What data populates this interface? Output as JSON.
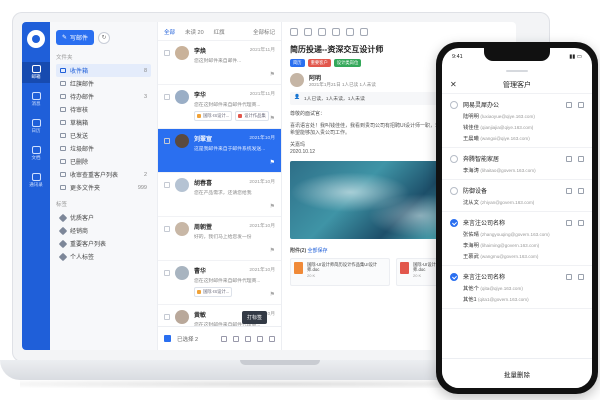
{
  "rail": {
    "items": [
      {
        "label": "邮箱",
        "active": true
      },
      {
        "label": "消息",
        "active": false
      },
      {
        "label": "日历",
        "active": false
      },
      {
        "label": "文档",
        "active": false
      },
      {
        "label": "通讯录",
        "active": false
      }
    ]
  },
  "folders": {
    "compose_label": "写邮件",
    "section_title": "文件夹",
    "items": [
      {
        "label": "收件箱",
        "count": "8",
        "active": true
      },
      {
        "label": "红旗邮件",
        "count": "",
        "active": false
      },
      {
        "label": "待办邮件",
        "count": "3",
        "active": false
      },
      {
        "label": "待审核",
        "count": "",
        "active": false
      },
      {
        "label": "草稿箱",
        "count": "",
        "active": false
      },
      {
        "label": "已发送",
        "count": "",
        "active": false
      },
      {
        "label": "垃圾邮件",
        "count": "",
        "active": false
      },
      {
        "label": "已删除",
        "count": "",
        "active": false
      },
      {
        "label": "收审查重客户列表",
        "count": "2",
        "active": false
      },
      {
        "label": "更多文件夹",
        "count": "999",
        "active": false
      }
    ],
    "tag_title": "标签",
    "tags": [
      {
        "label": "优质客户",
        "color": "#7d8799"
      },
      {
        "label": "经销商",
        "color": "#7d8799"
      },
      {
        "label": "重要客户列表",
        "color": "#7d8799"
      },
      {
        "label": "个人标签",
        "color": "#7d8799"
      }
    ]
  },
  "maillist": {
    "tabs": [
      {
        "label": "全部",
        "active": true
      },
      {
        "label": "未读 20",
        "active": false
      },
      {
        "label": "红旗",
        "active": false
      },
      {
        "label": "全部标记",
        "active": false
      }
    ],
    "mails": [
      {
        "name": "李焕",
        "date": "2021年11月",
        "subject": "您这封邮件来自邮件...",
        "chips": [],
        "selected": false,
        "avatar": "#c9b29a"
      },
      {
        "name": "李华",
        "date": "2021年11月",
        "subject": "您在这封邮件来自邮件代理商...",
        "chips": [
          {
            "label": "国际·IS设计...",
            "color": "#f0a238"
          },
          {
            "label": "设计作品集",
            "color": "#e2574c"
          }
        ],
        "selected": false,
        "avatar": "#9aaec6"
      },
      {
        "name": "刘翠宣",
        "date": "2021年10月",
        "subject": "这是我邮件来自于邮件系统发送...",
        "chips": [],
        "selected": true,
        "avatar": "#5a4a40"
      },
      {
        "name": "胡春喜",
        "date": "2021年10月",
        "subject": "您在产品需求，还请您给我",
        "chips": [],
        "selected": false,
        "avatar": "#b5c3d3"
      },
      {
        "name": "周朝萱",
        "date": "2021年10月",
        "subject": "好的，我们马上给您发一份",
        "chips": [],
        "selected": false,
        "avatar": "#c8b7a6"
      },
      {
        "name": "曹华",
        "date": "2021年10月",
        "subject": "您在这封邮件来自邮件代理商...",
        "chips": [
          {
            "label": "国际·IS设计...",
            "color": "#f0a238"
          }
        ],
        "selected": false,
        "avatar": "#a8b4c0"
      },
      {
        "name": "黄敏",
        "date": "2021年10月",
        "subject": "您在这封邮件来自邮件代理商...",
        "chips": [
          {
            "label": "国际·IS设计...",
            "color": "#f0a238"
          },
          {
            "label": "设计作品集",
            "color": "#e2574c"
          }
        ],
        "selected": false,
        "avatar": "#b9a89a"
      }
    ],
    "bulk_label": "已选择 2",
    "tooltip": "打标签"
  },
  "reader": {
    "subject": "简历投递--资深交互设计师",
    "tags": [
      {
        "label": "简历",
        "color": "#2a6ff0"
      },
      {
        "label": "重要客户",
        "color": "#e2574c"
      },
      {
        "label": "设计类岗位",
        "color": "#34a85a"
      }
    ],
    "sender": "阿明",
    "sender_meta": "2021年1月21日  1人已读  1人未读",
    "stats": "1人已读，1人未读，1人未读",
    "greeting": "尊敬的面试官：",
    "body": "喜讯语言处！我叫钱佳佳，我看到贵司公司有招聘UI设计师一职，非常感兴趣，附件是我的简历，希望能够加入贵公司工作。",
    "sign_name": "关嘉玛",
    "sign_date": "2020.10.12",
    "attach_head": "附件(2)",
    "attach_link": "全部保存",
    "attachments": [
      {
        "name": "国际-UI设计师简历设计作品集UI设计师.doc",
        "size": "20 K",
        "color": "#f08a38"
      },
      {
        "name": "国际-UI设计师简历设计作品集UI设计师.doc",
        "size": "20 K",
        "color": "#e2574c"
      }
    ]
  },
  "phone": {
    "time": "9:41",
    "title": "管理客户",
    "groups": [
      {
        "name": "网易灵犀办公",
        "checked": false,
        "contacts": [
          {
            "name": "陆明明",
            "email": "(luxiaoyue@qiye.163.com)"
          },
          {
            "name": "钱佳佳",
            "email": "(qianjiajia@qiye.163.com)"
          },
          {
            "name": "王晨曦",
            "email": "(wangxi@qiye.163.com)"
          }
        ]
      },
      {
        "name": "奔腾智能家居",
        "checked": false,
        "contacts": [
          {
            "name": "李海涛",
            "email": "(lihaitao@govern.163.com)"
          }
        ]
      },
      {
        "name": "防御设备",
        "checked": false,
        "contacts": [
          {
            "name": "沈从文",
            "email": "(zhiyan@govern.163.com)"
          }
        ]
      },
      {
        "name": "来言注公司名称",
        "checked": true,
        "contacts": [
          {
            "name": "张佑晴",
            "email": "(zhangyouqing@govern.163.com)"
          },
          {
            "name": "李海明",
            "email": "(lihaiming@govern.163.com)"
          },
          {
            "name": "王慕武",
            "email": "(wangmu@govern.163.com)"
          }
        ]
      },
      {
        "name": "来言注公司名称",
        "checked": true,
        "contacts": [
          {
            "name": "其他个",
            "email": "(qita@qiye.163.com)"
          },
          {
            "name": "其他1",
            "email": "(qita1@govern.163.com)"
          }
        ]
      }
    ],
    "batch_delete": "批量删除"
  }
}
